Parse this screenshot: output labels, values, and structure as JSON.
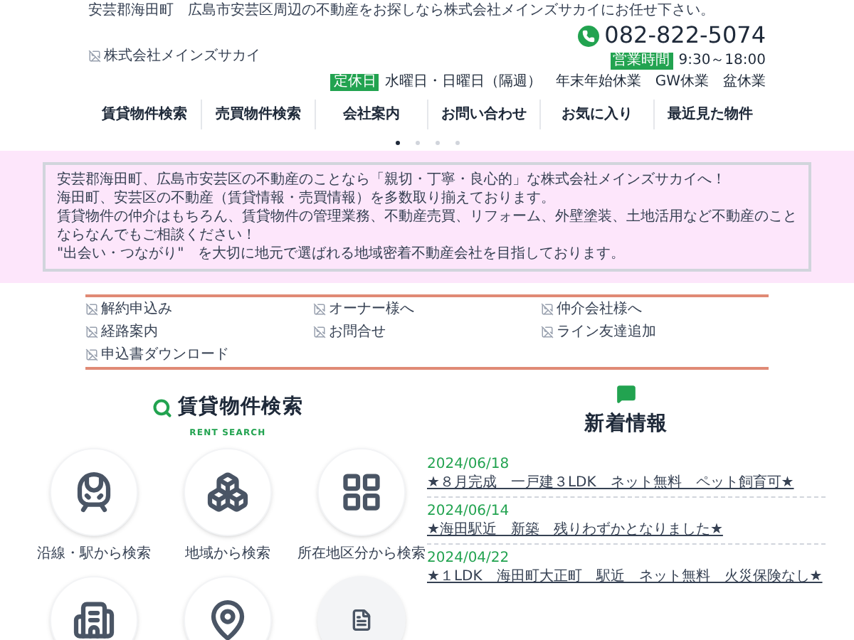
{
  "header": {
    "tagline": "安芸郡海田町　広島市安芸区周辺の不動産をお探しなら株式会社メインズサカイにお任せ下さい。",
    "logo_alt": "株式会社メインズサカイ",
    "phone": "082-822-5074",
    "hours_label": "営業時間",
    "hours": "9:30～18:00",
    "closed_label": "定休日",
    "closed": "水曜日・日曜日（隔週）　年末年始休業　GW休業　盆休業"
  },
  "nav": [
    "賃貸物件検索",
    "売買物件検索",
    "会社案内",
    "お問い合わせ",
    "お気に入り",
    "最近見た物件"
  ],
  "slider": {
    "dots": [
      {
        "selected": true
      },
      {
        "selected": false
      },
      {
        "selected": false
      },
      {
        "selected": false
      }
    ]
  },
  "intro": [
    "安芸郡海田町、広島市安芸区の不動産のことなら「親切・丁寧・良心的」な株式会社メインズサカイへ！",
    "海田町、安芸区の不動産（賃貸情報・売買情報）を多数取り揃えております。",
    "賃貸物件の仲介はもちろん、賃貸物件の管理業務、不動産売買、リフォーム、外壁塗装、土地活用など不動産のことならなんでもご相談ください！",
    "\"出会い・つながり\"　を大切に地元で選ばれる地域密着不動産会社を目指しております。"
  ],
  "links": [
    "解約申込み",
    "オーナー様へ",
    "仲介会社様へ",
    "経路案内",
    "お問合せ",
    "ライン友達追加",
    "申込書ダウンロード"
  ],
  "rent_search": {
    "title": "賃貸物件検索",
    "subtitle": "RENT SEARCH",
    "items": [
      {
        "kind": "train",
        "label": "沿線・駅から検索"
      },
      {
        "kind": "blocks",
        "label": "地域から検索"
      },
      {
        "kind": "grid",
        "label": "所在地区分から検索"
      },
      {
        "kind": "building"
      },
      {
        "kind": "pin"
      },
      {
        "kind": "document"
      }
    ]
  },
  "news": {
    "title": "新着情報",
    "items": [
      {
        "date": "2024/06/18",
        "text": "★８月完成　一戸建３LDK　ネット無料　ペット飼育可★"
      },
      {
        "date": "2024/06/14",
        "text": "★海田駅近　新築　残りわずかとなりました★"
      },
      {
        "date": "2024/04/22",
        "text": "★１LDK　海田町大正町　駅近　ネット無料　火災保険なし★"
      }
    ]
  }
}
